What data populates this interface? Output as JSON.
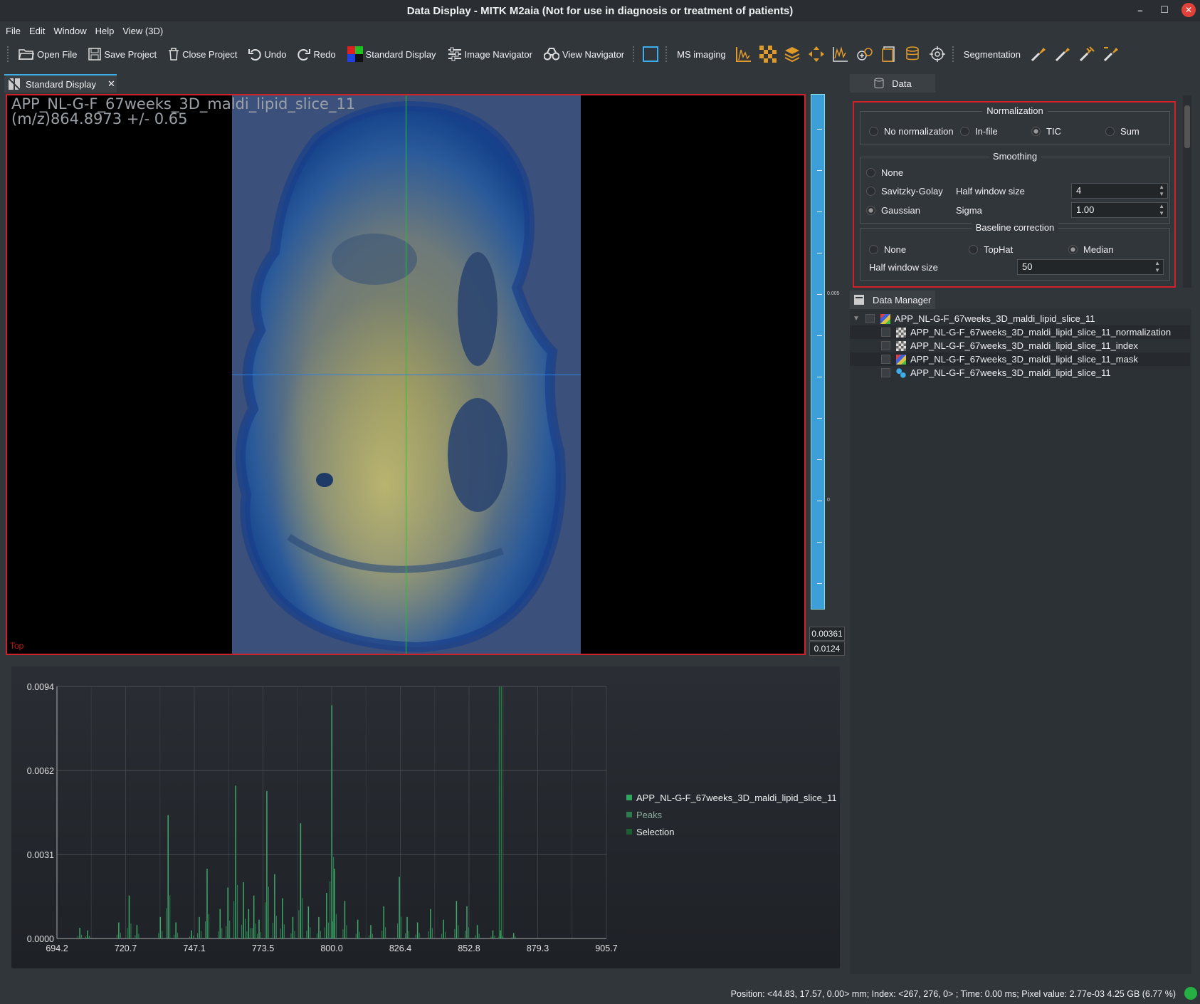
{
  "window": {
    "title": "Data Display - MITK M2aia (Not for use in diagnosis or treatment of patients)"
  },
  "menu": [
    "File",
    "Edit",
    "Window",
    "Help",
    "View (3D)"
  ],
  "toolbar": {
    "open_file": "Open File",
    "save_project": "Save Project",
    "close_project": "Close Project",
    "undo": "Undo",
    "redo": "Redo",
    "standard_display": "Standard Display",
    "image_navigator": "Image Navigator",
    "view_navigator": "View Navigator",
    "ms_imaging": "MS imaging",
    "segmentation": "Segmentation"
  },
  "viewer": {
    "tab_label": "Standard Display",
    "image_name": "APP_NL-G-F_67weeks_3D_maldi_lipid_slice_11",
    "mz_label": "(m/z)864.8973 +/- 0.65",
    "orientation": "Top",
    "scale_labels": [
      "0.005",
      "0"
    ],
    "range_max": "0.00361",
    "range_min": "0.0124"
  },
  "data_panel": {
    "tab_label": "Data",
    "normalization": {
      "title": "Normalization",
      "options": [
        "No normalization",
        "In-file",
        "TIC",
        "Sum"
      ],
      "selected": "TIC"
    },
    "smoothing": {
      "title": "Smoothing",
      "options": [
        "None",
        "Savitzky-Golay",
        "Gaussian"
      ],
      "selected": "Gaussian",
      "half_window_label": "Half window size",
      "half_window_value": "4",
      "sigma_label": "Sigma",
      "sigma_value": "1.00"
    },
    "baseline": {
      "title": "Baseline correction",
      "options": [
        "None",
        "TopHat",
        "Median"
      ],
      "selected": "Median",
      "half_window_label": "Half window size",
      "half_window_value": "50"
    }
  },
  "data_manager": {
    "tab_label": "Data Manager",
    "items": [
      "APP_NL-G-F_67weeks_3D_maldi_lipid_slice_11",
      "APP_NL-G-F_67weeks_3D_maldi_lipid_slice_11_normalization",
      "APP_NL-G-F_67weeks_3D_maldi_lipid_slice_11_index",
      "APP_NL-G-F_67weeks_3D_maldi_lipid_slice_11_mask",
      "APP_NL-G-F_67weeks_3D_maldi_lipid_slice_11"
    ]
  },
  "legend": [
    "APP_NL-G-F_67weeks_3D_maldi_lipid_slice_11",
    "Peaks",
    "Selection"
  ],
  "colors": {
    "accent": "#3daee9",
    "highlight": "#d0202a",
    "spectrum": "#3fa86a",
    "status_ok": "#26b043"
  },
  "status": "Position: <44.83, 17.57, 0.00> mm; Index: <267, 276, 0> ; Time: 0.00 ms; Pixel value: 2.77e-03  4.25 GB (6.77 %)",
  "chart_data": {
    "type": "bar",
    "xlabel": "",
    "ylabel": "",
    "xlim": [
      694.2,
      905.7
    ],
    "ylim": [
      0,
      0.0094
    ],
    "x_ticks": [
      "694.2",
      "720.7",
      "747.1",
      "773.5",
      "800.0",
      "826.4",
      "852.8",
      "879.3",
      "905.7"
    ],
    "y_ticks": [
      "0.0094",
      "0.0062",
      "0.0031",
      "0.0000"
    ],
    "series": [
      {
        "name": "APP_NL-G-F_67weeks_3D_maldi_lipid_slice_11",
        "x": [
          703,
          706,
          718,
          722,
          725,
          734,
          737,
          740,
          746,
          749,
          752,
          757,
          760,
          763,
          766,
          768,
          770,
          772,
          775,
          778,
          781,
          785,
          788,
          791,
          795,
          798,
          800,
          801,
          805,
          810,
          815,
          820,
          826,
          829,
          833,
          838,
          843,
          848,
          852,
          856,
          862,
          865,
          870
        ],
        "values": [
          0.0004,
          0.0003,
          0.0006,
          0.0016,
          0.0005,
          0.0008,
          0.0046,
          0.0006,
          0.0003,
          0.0008,
          0.0026,
          0.0011,
          0.0019,
          0.0057,
          0.0021,
          0.0011,
          0.0016,
          0.0007,
          0.0055,
          0.0024,
          0.0015,
          0.0008,
          0.0043,
          0.0012,
          0.0008,
          0.0017,
          0.0087,
          0.0026,
          0.0014,
          0.0007,
          0.0005,
          0.0012,
          0.0023,
          0.0008,
          0.0006,
          0.0011,
          0.0007,
          0.0014,
          0.0012,
          0.0005,
          0.0003,
          0.0003,
          0.0002
        ]
      }
    ],
    "selection_x": 864.9
  }
}
